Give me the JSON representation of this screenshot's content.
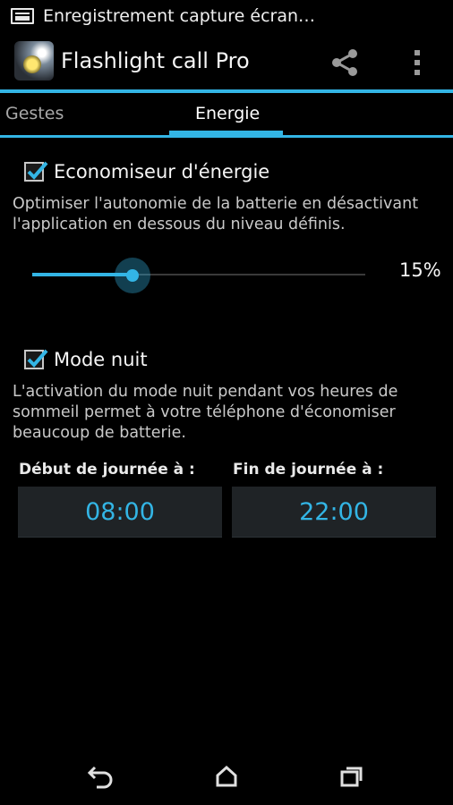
{
  "status_bar": {
    "notification_icon": "screen-recording-icon",
    "notification_text": "Enregistrement capture écran…"
  },
  "action_bar": {
    "app_icon": "flashlight-call-app-icon",
    "title": "Flashlight call Pro",
    "share_icon": "share-icon",
    "overflow_icon": "overflow-menu-icon"
  },
  "tabs": [
    {
      "label": "Gestes",
      "selected": false
    },
    {
      "label": "Energie",
      "selected": true
    }
  ],
  "energy_saver": {
    "checked": true,
    "label": "Economiseur d'énergie",
    "description": "Optimiser l'autonomie de la batterie en désactivant l'application en dessous du niveau définis.",
    "slider_percent": 30,
    "slider_value_text": "15%"
  },
  "night_mode": {
    "checked": true,
    "label": "Mode nuit",
    "description": "L'activation du mode nuit pendant vos heures de sommeil permet à votre téléphone d'économiser beaucoup de batterie.",
    "start_label": "Début de journée à :",
    "start_time": "08:00",
    "end_label": "Fin de journée à :",
    "end_time": "22:00"
  },
  "nav_bar": {
    "back_icon": "back-icon",
    "home_icon": "home-icon",
    "recents_icon": "recent-apps-icon"
  },
  "colors": {
    "accent": "#33b5e5",
    "background": "#000000"
  }
}
